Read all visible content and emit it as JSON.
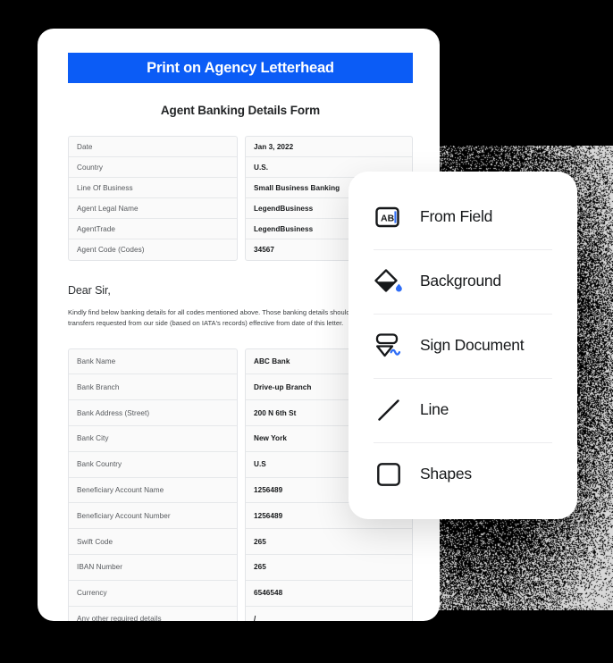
{
  "document": {
    "banner_title": "Print on Agency Letterhead",
    "subtitle": "Agent Banking Details Form",
    "salutation": "Dear Sir,",
    "body_paragraph": "Kindly find below banking details for all codes mentioned above. Those banking details should be used for any transfers requested from our side (based on IATA's records) effective from date of this letter.",
    "agent_table": {
      "rows": [
        {
          "label": "Date",
          "value": "Jan 3, 2022"
        },
        {
          "label": "Country",
          "value": "U.S."
        },
        {
          "label": "Line Of Business",
          "value": "Small Business Banking"
        },
        {
          "label": "Agent Legal Name",
          "value": "LegendBusiness"
        },
        {
          "label": "AgentTrade",
          "value": "LegendBusiness"
        },
        {
          "label": "Agent Code (Codes)",
          "value": "34567"
        }
      ]
    },
    "bank_table": {
      "rows": [
        {
          "label": "Bank Name",
          "value": "ABC Bank"
        },
        {
          "label": "Bank Branch",
          "value": "Drive-up Branch"
        },
        {
          "label": "Bank Address (Street)",
          "value": "200 N 6th St"
        },
        {
          "label": "Bank City",
          "value": "New York"
        },
        {
          "label": "Bank Country",
          "value": "U.S"
        },
        {
          "label": "Beneficiary Account Name",
          "value": "1256489"
        },
        {
          "label": "Beneficiary Account Number",
          "value": "1256489"
        },
        {
          "label": "Swift Code",
          "value": "265"
        },
        {
          "label": "IBAN Number",
          "value": "265"
        },
        {
          "label": "Currency",
          "value": "6546548"
        },
        {
          "label": "Any other required details",
          "value": "/"
        }
      ]
    }
  },
  "tool_panel": {
    "items": [
      {
        "label": "From Field",
        "icon": "text-field-icon"
      },
      {
        "label": "Background",
        "icon": "paint-bucket-icon"
      },
      {
        "label": "Sign Document",
        "icon": "sign-document-icon"
      },
      {
        "label": "Line",
        "icon": "line-icon"
      },
      {
        "label": "Shapes",
        "icon": "shapes-icon"
      }
    ]
  },
  "colors": {
    "banner_blue": "#0b5cf6",
    "accent_blue": "#2f6df6",
    "ink": "#16181a",
    "canvas": "#000000"
  }
}
